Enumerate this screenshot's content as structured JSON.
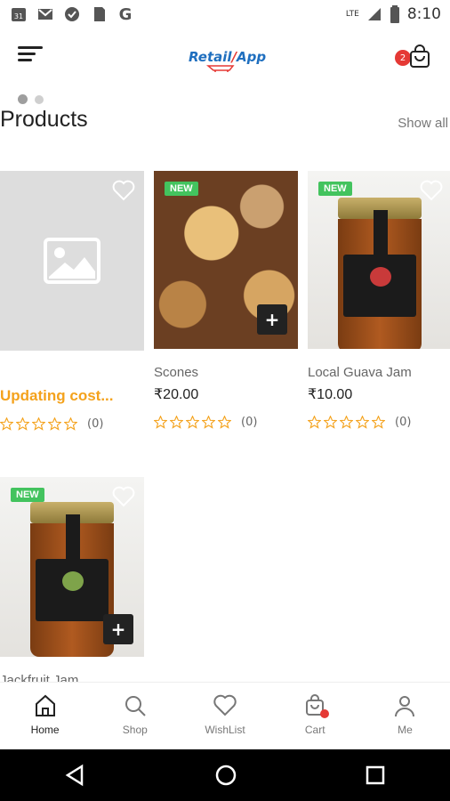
{
  "status_bar": {
    "time": "8:10",
    "network": "LTE",
    "icons": [
      "calendar-icon",
      "gmail-icon",
      "shield-check-icon",
      "sd-card-icon",
      "google-icon",
      "signal-icon",
      "battery-icon"
    ]
  },
  "header": {
    "logo_text_a": "Retail",
    "logo_text_b": "App",
    "cart_count": "2"
  },
  "carousel": {
    "dots": 2,
    "active_index": 0
  },
  "products_section": {
    "title": "Products",
    "show_all": "Show all"
  },
  "products": [
    {
      "name": "",
      "price": "Updating cost...",
      "new": false,
      "rating_count": "(0)",
      "image": "placeholder"
    },
    {
      "name": "Scones",
      "price": "₹20.00",
      "new": true,
      "new_label": "NEW",
      "rating_count": "(0)",
      "image": "scones"
    },
    {
      "name": "Local Guava Jam",
      "price": "₹10.00",
      "new": true,
      "new_label": "NEW",
      "rating_count": "(0)",
      "image": "guava-jam"
    },
    {
      "name": "Jackfruit Jam",
      "new": true,
      "new_label": "NEW",
      "image": "jackfruit-jam"
    }
  ],
  "bottom_nav": [
    {
      "label": "Home",
      "active": true
    },
    {
      "label": "Shop",
      "active": false
    },
    {
      "label": "WishList",
      "active": false
    },
    {
      "label": "Cart",
      "active": false
    },
    {
      "label": "Me",
      "active": false
    }
  ],
  "colors": {
    "new_badge": "#43c35e",
    "price_alert": "#f4a21c",
    "cart_badge": "#e53935",
    "star": "#f4a21c"
  }
}
